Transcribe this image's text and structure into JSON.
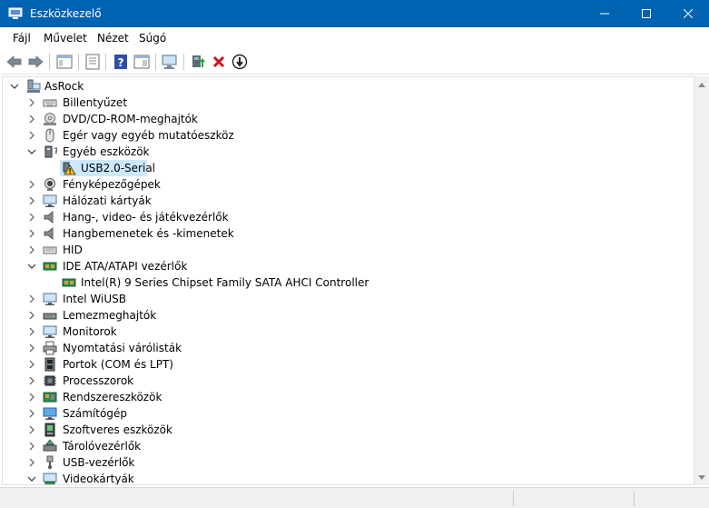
{
  "window": {
    "title": "Eszközkezelő",
    "accent": "#0063b1"
  },
  "menu": [
    {
      "label": "Fájl"
    },
    {
      "label": "Művelet"
    },
    {
      "label": "Nézet"
    },
    {
      "label": "Súgó"
    }
  ],
  "toolbar": [
    "back-icon",
    "forward-icon",
    "show-hide-tree-icon",
    "properties-icon",
    "help-icon",
    "action-pane-icon",
    "scan-hardware-icon",
    "update-driver-icon",
    "uninstall-device-icon",
    "disable-device-icon"
  ],
  "tree": {
    "root": "AsRock",
    "items": [
      {
        "label": "Billentyűzet",
        "icon": "keyboard-icon",
        "expanded": false
      },
      {
        "label": "DVD/CD-ROM-meghajtók",
        "icon": "dvd-drive-icon",
        "expanded": false
      },
      {
        "label": "Egér vagy egyéb mutatóeszköz",
        "icon": "mouse-icon",
        "expanded": false
      },
      {
        "label": "Egyéb eszközök",
        "icon": "other-devices-icon",
        "expanded": true
      },
      {
        "label": "USB2.0-Serial",
        "icon": "warning-device-icon",
        "child": true,
        "selected": true
      },
      {
        "label": "Fényképezőgépek",
        "icon": "camera-icon",
        "expanded": false
      },
      {
        "label": "Hálózati kártyák",
        "icon": "network-adapter-icon",
        "expanded": false
      },
      {
        "label": "Hang-, video- és játékvezérlők",
        "icon": "speaker-icon",
        "expanded": false
      },
      {
        "label": "Hangbemenetek és -kimenetek",
        "icon": "audio-io-icon",
        "expanded": false
      },
      {
        "label": "HID",
        "icon": "hid-icon",
        "expanded": false
      },
      {
        "label": "IDE ATA/ATAPI vezérlők",
        "icon": "ide-controller-icon",
        "expanded": true
      },
      {
        "label": "Intel(R) 9 Series Chipset Family SATA AHCI Controller",
        "icon": "controller-chip-icon",
        "child": true
      },
      {
        "label": "Intel WiUSB",
        "icon": "monitor-icon",
        "expanded": false
      },
      {
        "label": "Lemezmeghajtók",
        "icon": "disk-drive-icon",
        "expanded": false
      },
      {
        "label": "Monitorok",
        "icon": "monitor-icon",
        "expanded": false
      },
      {
        "label": "Nyomtatási várólisták",
        "icon": "printer-icon",
        "expanded": false
      },
      {
        "label": "Portok (COM és LPT)",
        "icon": "port-icon",
        "expanded": false
      },
      {
        "label": "Processzorok",
        "icon": "cpu-icon",
        "expanded": false
      },
      {
        "label": "Rendszereszközök",
        "icon": "system-device-icon",
        "expanded": false
      },
      {
        "label": "Számítógép",
        "icon": "computer-icon",
        "expanded": false
      },
      {
        "label": "Szoftveres eszközök",
        "icon": "software-device-icon",
        "expanded": false
      },
      {
        "label": "Tárolóvezérlők",
        "icon": "storage-controller-icon",
        "expanded": false
      },
      {
        "label": "USB-vezérlők",
        "icon": "usb-icon",
        "expanded": false
      },
      {
        "label": "Videokártyák",
        "icon": "display-adapter-icon",
        "expanded": true
      }
    ]
  }
}
